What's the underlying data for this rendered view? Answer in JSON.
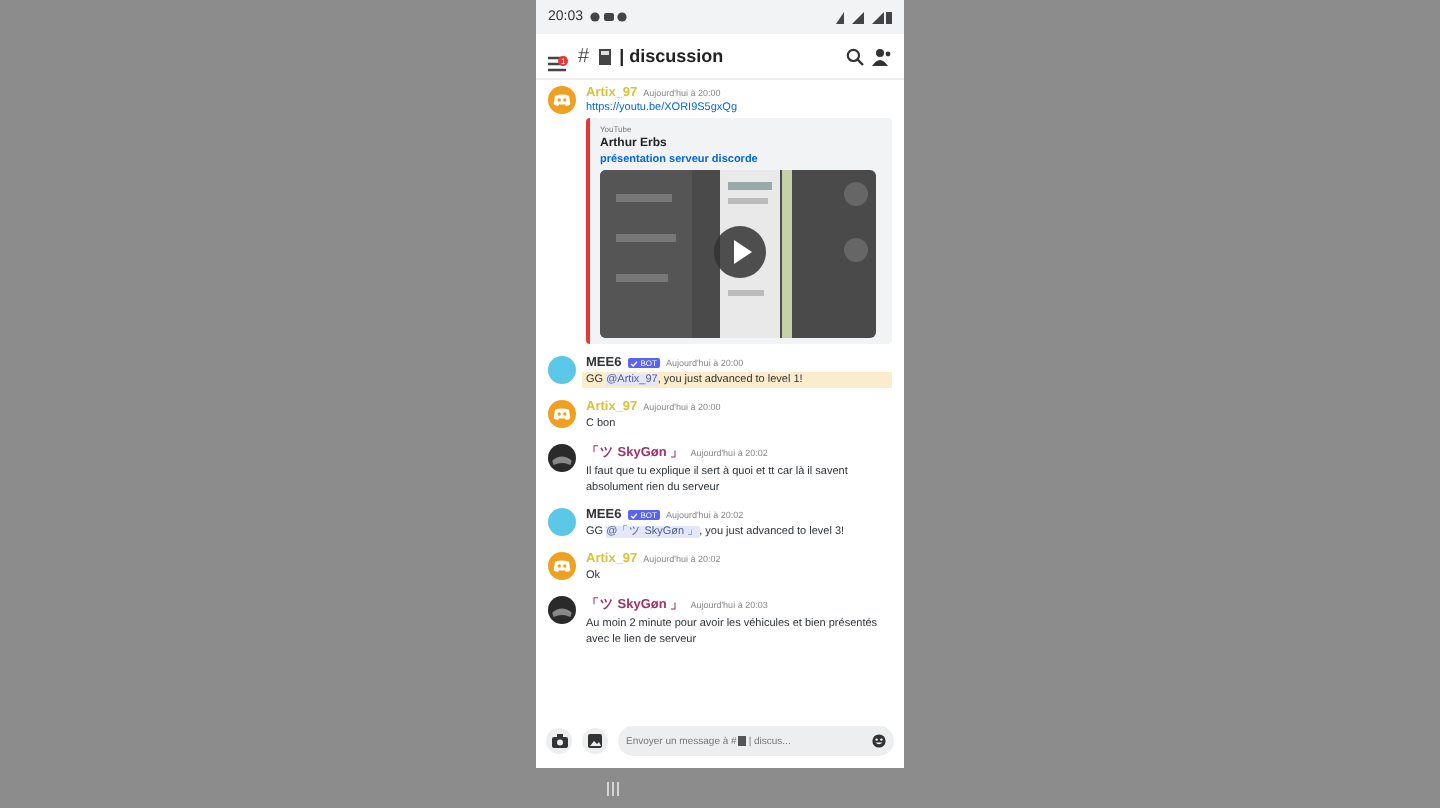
{
  "status_bar": {
    "time": "20:03"
  },
  "header": {
    "badge": "1",
    "hash": "#",
    "channel": "| discussion"
  },
  "first_message": {
    "author": "Artix_97",
    "time": "Aujourd'hui à 20:00",
    "link": "https://youtu.be/XORI9S5gxQg",
    "embed": {
      "provider": "YouTube",
      "title": "Arthur Erbs",
      "link": "présentation serveur discorde"
    }
  },
  "messages": [
    {
      "kind": "bot",
      "author": "MEE6",
      "color": "#303338",
      "bot_tag": "BOT",
      "time": "Aujourd'hui à 20:00",
      "highlighted": true,
      "segments": [
        {
          "kind": "plain",
          "text": "GG "
        },
        {
          "kind": "mention",
          "text": "@Artix_97"
        },
        {
          "kind": "plain",
          "text": ", you just advanced to level 1!"
        }
      ]
    },
    {
      "kind": "logo",
      "author": "Artix_97",
      "color": "#d8c23a",
      "time": "Aujourd'hui à 20:00",
      "highlighted": false,
      "segments": [
        {
          "kind": "plain",
          "text": "C bon"
        }
      ]
    },
    {
      "author": "「ツ SkyGøn 」",
      "color": "#a0306a",
      "time": "Aujourd'hui à 20:02",
      "highlighted": false,
      "segments": [
        {
          "kind": "plain",
          "text": "Il faut que tu explique il sert à quoi et tt car là il savent absolument rien du serveur"
        }
      ]
    },
    {
      "kind": "bot",
      "author": "MEE6",
      "color": "#303338",
      "bot_tag": "BOT",
      "time": "Aujourd'hui à 20:02",
      "highlighted": false,
      "segments": [
        {
          "kind": "plain",
          "text": "GG "
        },
        {
          "kind": "mention",
          "text": "@「ツ SkyGøn 」"
        },
        {
          "kind": "plain",
          "text": ", you just advanced to level 3!"
        }
      ]
    },
    {
      "kind": "logo",
      "author": "Artix_97",
      "color": "#d8c23a",
      "time": "Aujourd'hui à 20:02",
      "highlighted": false,
      "segments": [
        {
          "kind": "plain",
          "text": "Ok"
        }
      ]
    },
    {
      "author": "「ツ SkyGøn 」",
      "color": "#a0306a",
      "time": "Aujourd'hui à 20:03",
      "highlighted": false,
      "segments": [
        {
          "kind": "plain",
          "text": "Au moin 2 minute pour avoir les véhicules et bien présentés avec le lien de serveur"
        }
      ]
    }
  ],
  "composer": {
    "hint_before": "Envoyer un message à #",
    "hint_after": "| discus..."
  }
}
